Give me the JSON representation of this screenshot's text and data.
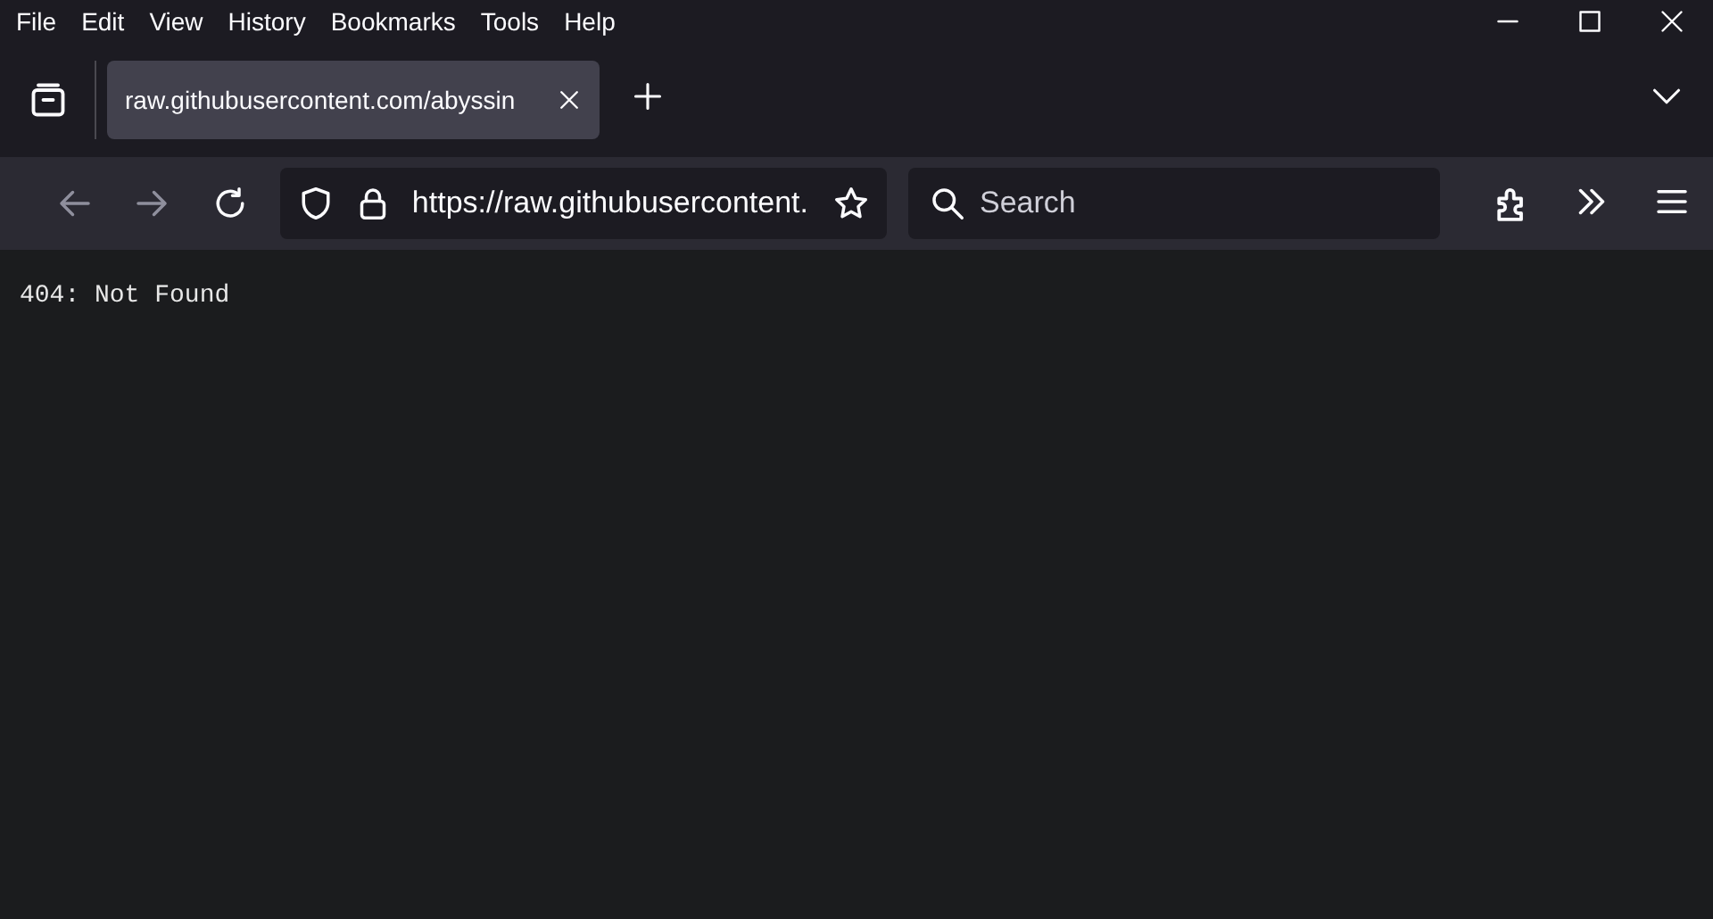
{
  "menu_bar": [
    "File",
    "Edit",
    "View",
    "History",
    "Bookmarks",
    "Tools",
    "Help"
  ],
  "tabs": [
    {
      "title": "raw.githubusercontent.com/abyssin",
      "selected": true
    }
  ],
  "nav": {
    "back_disabled": true,
    "forward_disabled": true,
    "url": "https://raw.githubusercontent.",
    "search": {
      "placeholder": "Search"
    }
  },
  "page": {
    "text": "404: Not Found"
  }
}
